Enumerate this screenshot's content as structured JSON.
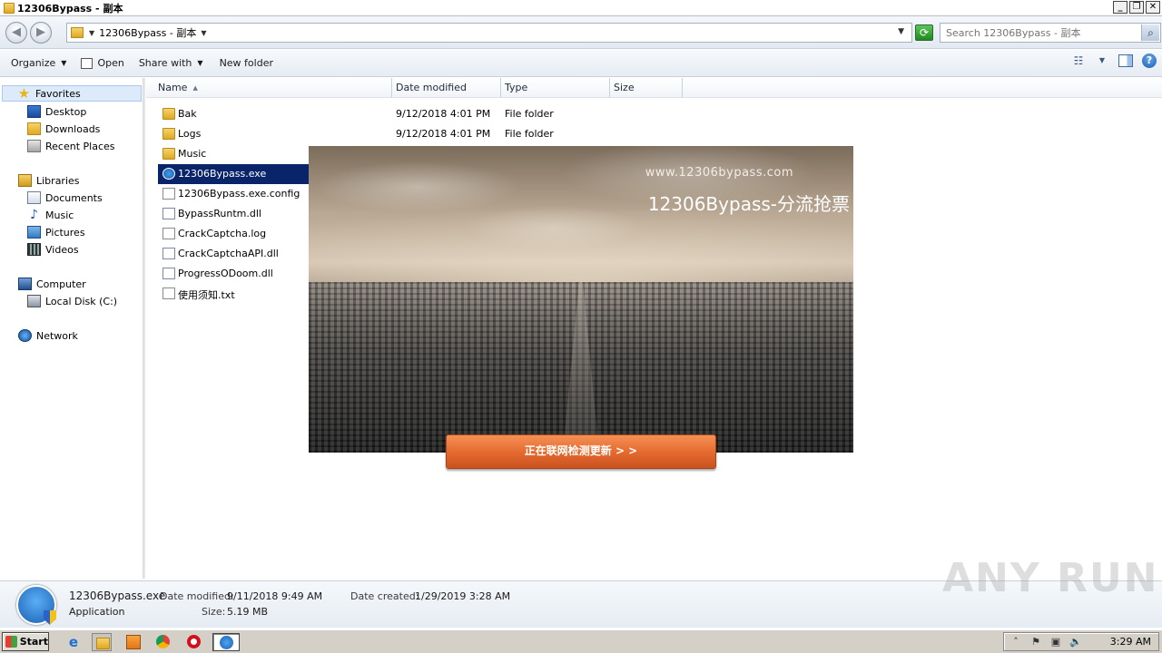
{
  "window": {
    "title": "12306Bypass - 副本",
    "controls": [
      "_",
      "❐",
      "✕"
    ]
  },
  "address": {
    "breadcrumb": "12306Bypass - 副本",
    "search_placeholder": "Search 12306Bypass - 副本"
  },
  "toolbar": {
    "organize": "Organize",
    "open": "Open",
    "share_with": "Share with",
    "new_folder": "New folder"
  },
  "navpane": {
    "favorites": "Favorites",
    "desktop": "Desktop",
    "downloads": "Downloads",
    "recent_places": "Recent Places",
    "libraries": "Libraries",
    "documents": "Documents",
    "music": "Music",
    "pictures": "Pictures",
    "videos": "Videos",
    "computer": "Computer",
    "local_disk": "Local Disk (C:)",
    "network": "Network"
  },
  "columns": {
    "name": "Name",
    "date_modified": "Date modified",
    "type": "Type",
    "size": "Size"
  },
  "files": [
    {
      "name": "Bak",
      "date": "9/12/2018 4:01 PM",
      "type": "File folder",
      "icon": "folder-icon"
    },
    {
      "name": "Logs",
      "date": "9/12/2018 4:01 PM",
      "type": "File folder",
      "icon": "folder-icon"
    },
    {
      "name": "Music",
      "date": "",
      "type": "",
      "icon": "folder-icon"
    },
    {
      "name": "12306Bypass.exe",
      "date": "",
      "type": "",
      "icon": "exe-icon"
    },
    {
      "name": "12306Bypass.exe.config",
      "date": "",
      "type": "",
      "icon": "file-icon"
    },
    {
      "name": "BypassRuntm.dll",
      "date": "",
      "type": "",
      "icon": "dll-icon"
    },
    {
      "name": "CrackCaptcha.log",
      "date": "",
      "type": "",
      "icon": "file-icon"
    },
    {
      "name": "CrackCaptchaAPI.dll",
      "date": "",
      "type": "",
      "icon": "dll-icon"
    },
    {
      "name": "ProgressODoom.dll",
      "date": "",
      "type": "",
      "icon": "dll-icon"
    },
    {
      "name": "使用须知.txt",
      "date": "",
      "type": "",
      "icon": "file-icon"
    }
  ],
  "splash": {
    "url": "www.12306bypass.com",
    "brand": "12306Bypass-分流抢票",
    "button": "正在联网检测更新 > >"
  },
  "details": {
    "filename": "12306Bypass.exe",
    "filetype": "Application",
    "date_modified_label": "Date modified:",
    "date_modified": "9/11/2018 9:49 AM",
    "date_created_label": "Date created:",
    "date_created": "1/29/2019 3:28 AM",
    "size_label": "Size:",
    "size": "5.19 MB"
  },
  "watermark": "ANY RUN",
  "taskbar": {
    "start": "Start",
    "clock": "3:29 AM"
  }
}
